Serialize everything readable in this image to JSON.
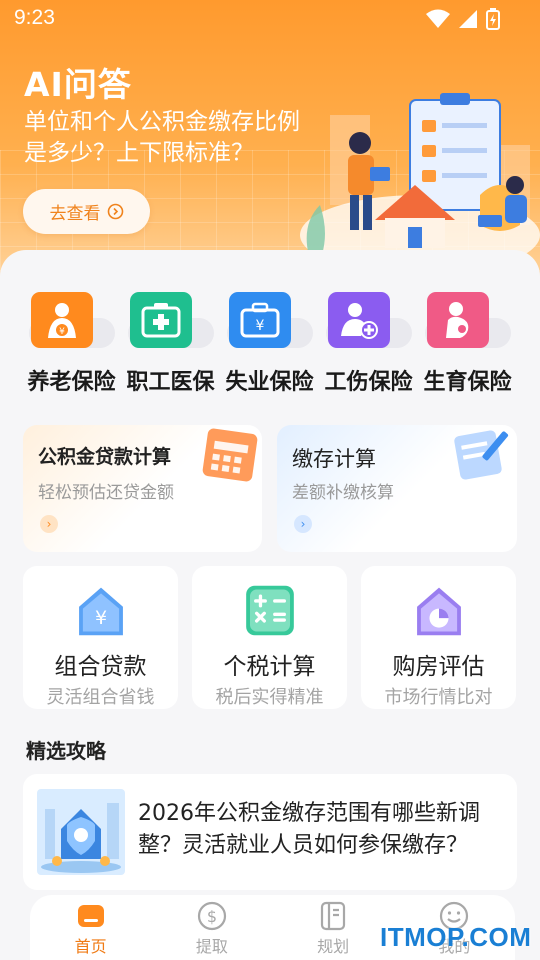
{
  "status_bar": {
    "time": "9:23"
  },
  "banner": {
    "title": "AI问答",
    "subtitle": "单位和个人公积金缴存比例是多少？上下限标准？",
    "button_label": "去查看"
  },
  "insurance": [
    {
      "label": "养老保险",
      "icon": "elderly-care-icon",
      "color": "#ff8a1e"
    },
    {
      "label": "职工医保",
      "icon": "medical-kit-icon",
      "color": "#1fbf8f"
    },
    {
      "label": "失业保险",
      "icon": "briefcase-yuan-icon",
      "color": "#2f8cf0"
    },
    {
      "label": "工伤保险",
      "icon": "injury-person-icon",
      "color": "#8b5cf0"
    },
    {
      "label": "生育保险",
      "icon": "pregnancy-icon",
      "color": "#f05a86"
    }
  ],
  "calculators": [
    {
      "title": "公积金贷款计算",
      "subtitle": "轻松预估还贷金额",
      "accent": "#ff9b3a"
    },
    {
      "title": "缴存计算",
      "subtitle": "差额补缴核算",
      "accent": "#3d8ef0"
    }
  ],
  "tools": [
    {
      "title": "组合贷款",
      "subtitle": "灵活组合省钱",
      "icon": "house-yuan-icon"
    },
    {
      "title": "个税计算",
      "subtitle": "税后实得精准",
      "icon": "calculator-icon"
    },
    {
      "title": "购房评估",
      "subtitle": "市场行情比对",
      "icon": "house-chart-icon"
    }
  ],
  "section": {
    "title": "精选攻略"
  },
  "article": {
    "title": "2026年公积金缴存范围有哪些新调整？灵活就业人员如何参保缴存？"
  },
  "tabbar": [
    {
      "label": "首页",
      "icon": "home-icon",
      "active": true
    },
    {
      "label": "提取",
      "icon": "dollar-coin-icon",
      "active": false
    },
    {
      "label": "规划",
      "icon": "notebook-icon",
      "active": false
    },
    {
      "label": "我的",
      "icon": "smiley-face-icon",
      "active": false
    }
  ],
  "watermark": "ITMOP.COM"
}
